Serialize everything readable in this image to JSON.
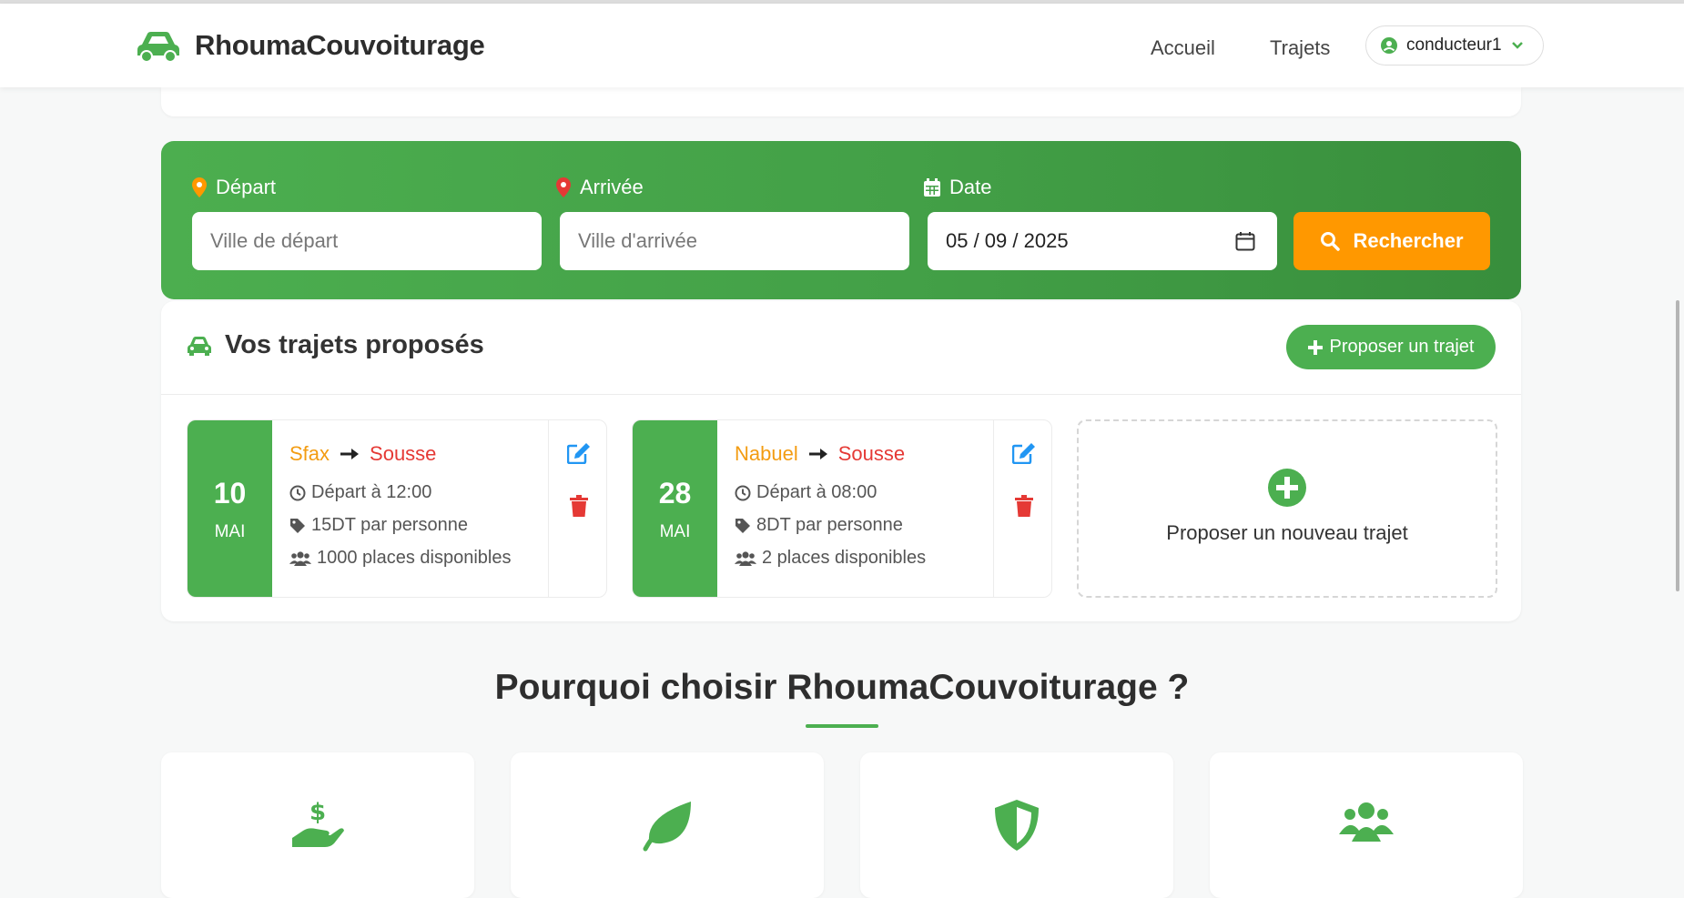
{
  "brand": {
    "name": "RhoumaCouvoiturage"
  },
  "nav": {
    "home": "Accueil",
    "trips": "Trajets",
    "user": "conducteur1"
  },
  "search": {
    "departure_label": "Départ",
    "arrival_label": "Arrivée",
    "date_label": "Date",
    "departure_placeholder": "Ville de départ",
    "arrival_placeholder": "Ville d'arrivée",
    "date_value": "05 / 09 / 2025",
    "button": "Rechercher"
  },
  "trips": {
    "title": "Vos trajets proposés",
    "propose_button": "Proposer un trajet",
    "items": [
      {
        "day": "10",
        "month": "MAI",
        "from": "Sfax",
        "to": "Sousse",
        "time": "Départ à 12:00",
        "price": "15DT par personne",
        "seats": "1000 places disponibles"
      },
      {
        "day": "28",
        "month": "MAI",
        "from": "Nabuel",
        "to": "Sousse",
        "time": "Départ à 08:00",
        "price": "8DT par personne",
        "seats": "2 places disponibles"
      }
    ],
    "new_trip_label": "Proposer un nouveau trajet"
  },
  "why": {
    "title": "Pourquoi choisir RhoumaCouvoiturage ?",
    "features": [
      {
        "icon": "hand-dollar-icon"
      },
      {
        "icon": "leaf-icon"
      },
      {
        "icon": "shield-icon"
      },
      {
        "icon": "users-icon"
      }
    ]
  },
  "colors": {
    "primary": "#4caf50",
    "accent": "#ff9800",
    "danger": "#e53935",
    "edit": "#2196f3",
    "from": "#f39c12"
  }
}
